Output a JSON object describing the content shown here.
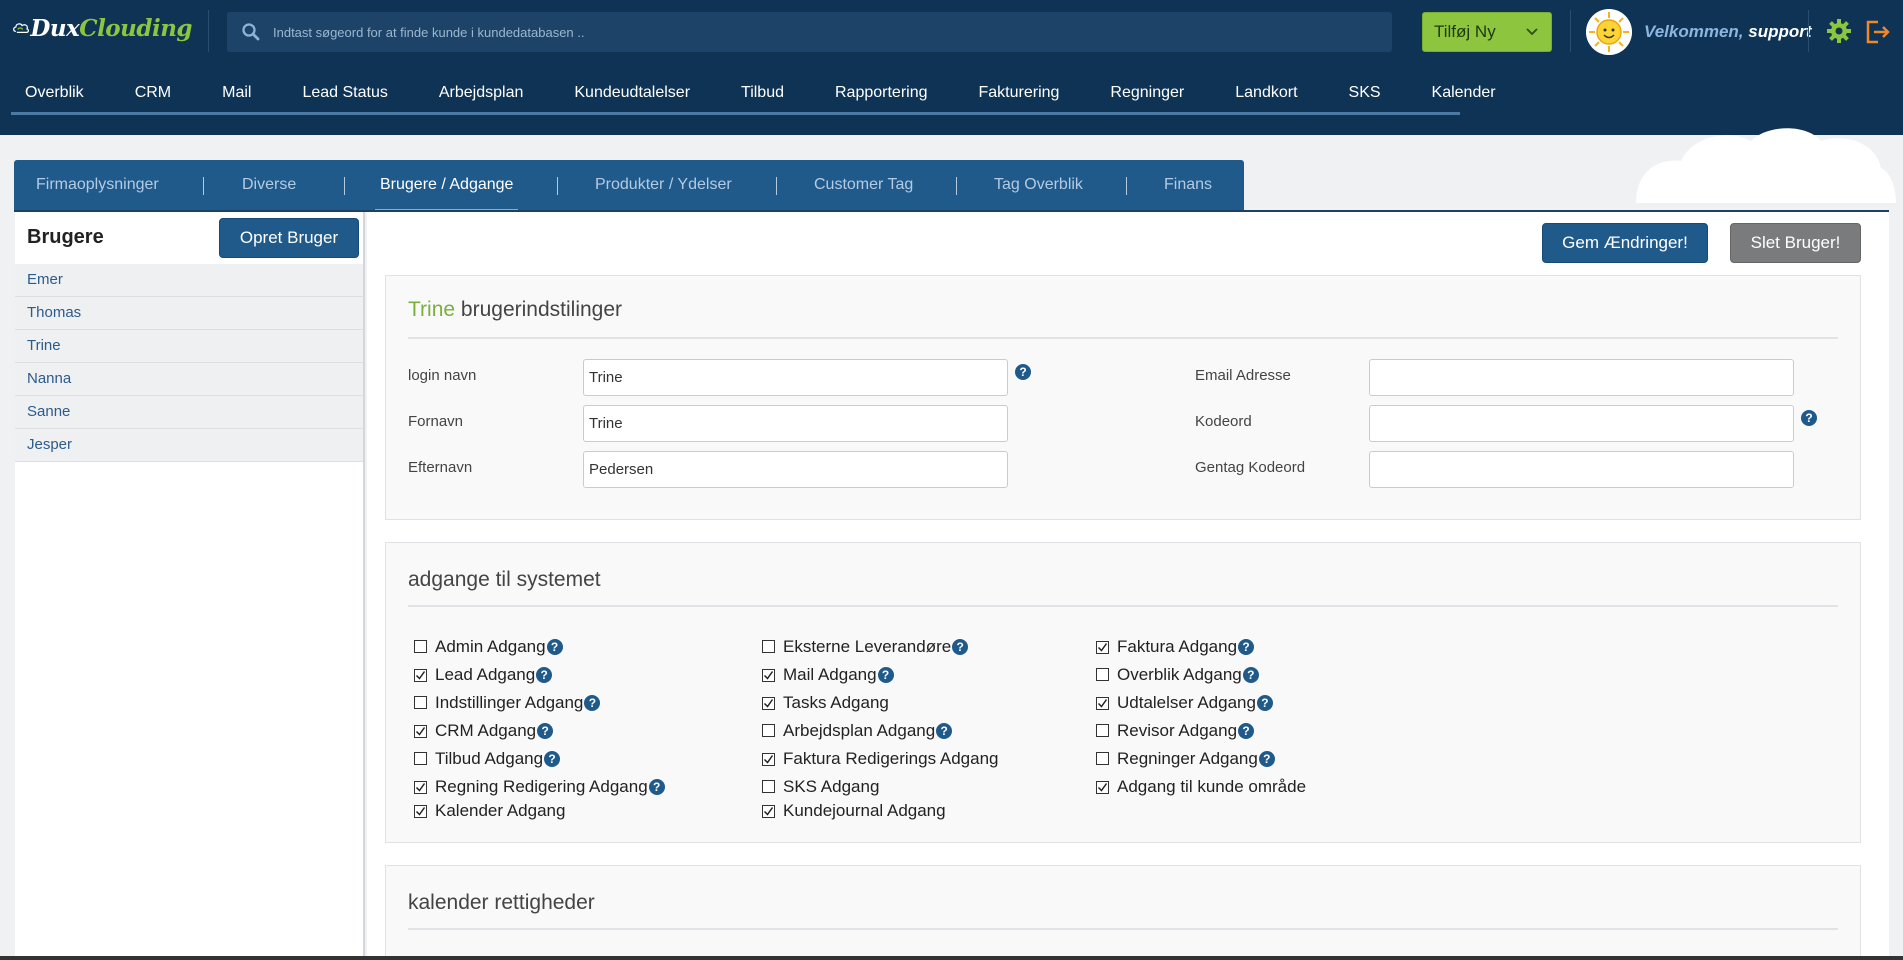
{
  "app": {
    "logo_text_part1": "Dux",
    "logo_text_part2": "Clouding",
    "search_placeholder": "Indtast søgeord for at finde kunde i kundedatabasen ..",
    "add_new_label": "Tilføj Ny",
    "welcome_prefix": "Velkommen,",
    "welcome_user": "support"
  },
  "main_nav": [
    "Overblik",
    "CRM",
    "Mail",
    "Lead Status",
    "Arbejdsplan",
    "Kundeudtalelser",
    "Tilbud",
    "Rapportering",
    "Fakturering",
    "Regninger",
    "Landkort",
    "SKS",
    "Kalender"
  ],
  "tabs": [
    {
      "label": "Firmaoplysninger",
      "active": false
    },
    {
      "label": "Diverse",
      "active": false
    },
    {
      "label": "Brugere / Adgange",
      "active": true
    },
    {
      "label": "Produkter / Ydelser",
      "active": false
    },
    {
      "label": "Customer Tag",
      "active": false
    },
    {
      "label": "Tag Overblik",
      "active": false
    },
    {
      "label": "Finans",
      "active": false
    }
  ],
  "users_panel": {
    "title": "Brugere",
    "create_label": "Opret Bruger",
    "users": [
      "Emer",
      "Thomas",
      "Trine",
      "Nanna",
      "Sanne",
      "Jesper"
    ]
  },
  "actions": {
    "save_label": "Gem Ændringer!",
    "delete_label": "Slet Bruger!"
  },
  "settings": {
    "user_name": "Trine",
    "heading_suffix": "brugerindstilinger",
    "fields": {
      "login_label": "login navn",
      "login_value": "Trine",
      "first_label": "Fornavn",
      "first_value": "Trine",
      "last_label": "Efternavn",
      "last_value": "Pedersen",
      "email_label": "Email Adresse",
      "email_value": "",
      "password_label": "Kodeord",
      "password_value": "",
      "repeat_label": "Gentag Kodeord",
      "repeat_value": ""
    }
  },
  "access": {
    "heading": "adgange til systemet",
    "columns": [
      [
        {
          "label": "Admin Adgang",
          "checked": false,
          "help": true
        },
        {
          "label": "Lead Adgang",
          "checked": true,
          "help": true
        },
        {
          "label": "Indstillinger Adgang",
          "checked": false,
          "help": true
        },
        {
          "label": "CRM Adgang",
          "checked": true,
          "help": true
        },
        {
          "label": "Tilbud Adgang",
          "checked": false,
          "help": true
        },
        {
          "label": "Regning Redigering Adgang",
          "checked": true,
          "help": true
        },
        {
          "label": "Kalender Adgang",
          "checked": true,
          "help": false
        }
      ],
      [
        {
          "label": "Eksterne Leverandøre",
          "checked": false,
          "help": true
        },
        {
          "label": "Mail Adgang",
          "checked": true,
          "help": true
        },
        {
          "label": "Tasks Adgang",
          "checked": true,
          "help": false
        },
        {
          "label": "Arbejdsplan Adgang",
          "checked": false,
          "help": true
        },
        {
          "label": "Faktura Redigerings Adgang",
          "checked": true,
          "help": false
        },
        {
          "label": "SKS Adgang",
          "checked": false,
          "help": false
        },
        {
          "label": "Kundejournal Adgang",
          "checked": true,
          "help": false
        }
      ],
      [
        {
          "label": "Faktura Adgang",
          "checked": true,
          "help": true
        },
        {
          "label": "Overblik Adgang",
          "checked": false,
          "help": true
        },
        {
          "label": "Udtalelser Adgang",
          "checked": true,
          "help": true
        },
        {
          "label": "Revisor Adgang",
          "checked": false,
          "help": true
        },
        {
          "label": "Regninger Adgang",
          "checked": false,
          "help": true
        },
        {
          "label": "Adgang til kunde område",
          "checked": true,
          "help": false
        }
      ]
    ]
  },
  "calendar": {
    "heading": "kalender rettigheder"
  }
}
